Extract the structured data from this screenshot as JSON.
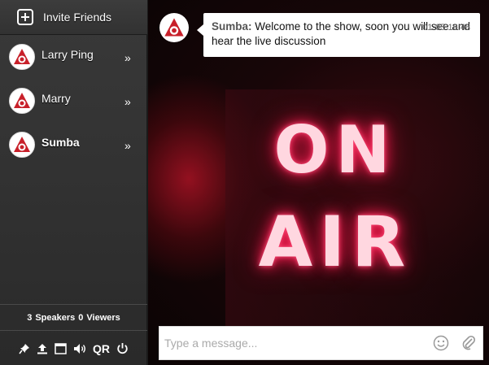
{
  "sidebar": {
    "invite_label": "Invite Friends",
    "users": [
      {
        "name": "Larry Ping",
        "bold": false
      },
      {
        "name": "Marry",
        "bold": false
      },
      {
        "name": "Sumba",
        "bold": true
      }
    ],
    "chevron": "»",
    "counts": {
      "speakers": "3",
      "speakers_label": "Speakers",
      "viewers": "0",
      "viewers_label": "Viewers"
    },
    "toolbar": {
      "icons": [
        "pin-icon",
        "upload-icon",
        "window-icon",
        "speaker-icon",
        "qr-icon",
        "power-icon"
      ],
      "qr_label": "QR"
    }
  },
  "stage": {
    "sign_line1": "ON",
    "sign_line2": "AIR",
    "message": {
      "sender": "Sumba:",
      "text": " Welcome to the show, soon you will see and hear the live discussion",
      "time": "01-05 16:48"
    },
    "composer": {
      "placeholder": "Type a message...",
      "icons": [
        "emoji-icon",
        "attach-icon"
      ]
    }
  },
  "colors": {
    "brand_red": "#c8202a",
    "sidebar_bg": "#333333",
    "neon": "#ff1f55"
  }
}
